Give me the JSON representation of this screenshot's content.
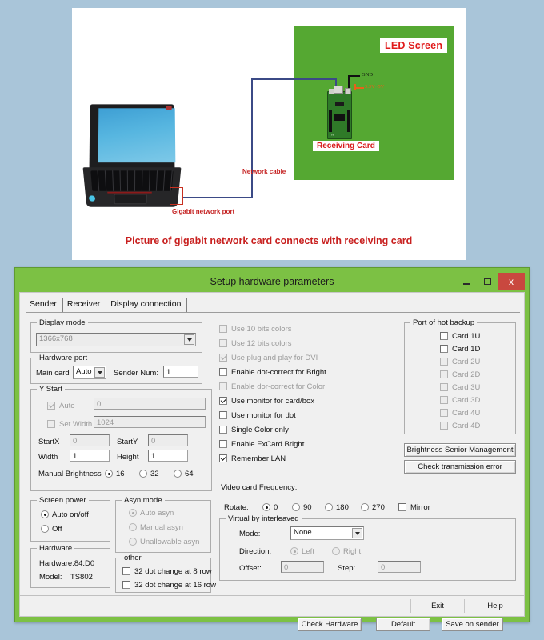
{
  "illustration": {
    "led_screen_label": "LED Screen",
    "receiving_card_label": "Receiving Card",
    "gnd_label": "GND",
    "voltage_label": "3.3V~5V",
    "network_cable_label": "Network cable",
    "gigabit_port_label": "Gigabit network port",
    "caption": "Picture of gigabit network card connects with receiving card",
    "colors": {
      "led_green": "#55a832",
      "red_text": "#c8201f",
      "cable_blue": "#3b4a86",
      "page_background": "#a9c5d9"
    }
  },
  "window": {
    "title": "Setup hardware parameters",
    "minimize_label": "–",
    "maximize_label": "□",
    "close_label": "x",
    "frame_color": "#7cc144",
    "close_color": "#c9483f"
  },
  "tabs": [
    {
      "label": "Sender",
      "active": true
    },
    {
      "label": "Receiver",
      "active": false
    },
    {
      "label": "Display connection",
      "active": false
    }
  ],
  "display_mode": {
    "legend": "Display mode",
    "value": "1366x768",
    "disabled": true
  },
  "hardware_port": {
    "legend": "Hardware port",
    "main_card_label": "Main card",
    "main_card_value": "Auto",
    "sender_num_label": "Sender Num:",
    "sender_num_value": "1"
  },
  "y_start": {
    "legend": "Y Start",
    "auto_label": "Auto",
    "auto_checked": true,
    "auto_value": "0",
    "set_width_label": "Set Width",
    "set_width_checked": false,
    "set_width_value": "1024",
    "startx_label": "StartX",
    "startx_value": "0",
    "starty_label": "StartY",
    "starty_value": "0",
    "width_label": "Width",
    "width_value": "1",
    "height_label": "Height",
    "height_value": "1",
    "manual_brightness_label": "Manual Brightness",
    "brightness_options": [
      {
        "label": "16",
        "selected": true
      },
      {
        "label": "32",
        "selected": false
      },
      {
        "label": "64",
        "selected": false
      }
    ]
  },
  "screen_power": {
    "legend": "Screen power",
    "options": [
      {
        "label": "Auto on/off",
        "selected": true
      },
      {
        "label": "Off",
        "selected": false
      }
    ]
  },
  "asyn_mode": {
    "legend": "Asyn mode",
    "disabled": true,
    "options": [
      {
        "label": "Auto asyn",
        "selected": true
      },
      {
        "label": "Manual asyn",
        "selected": false
      },
      {
        "label": "Unallowable asyn",
        "selected": false
      }
    ]
  },
  "hardware_info": {
    "legend": "Hardware",
    "hardware_line": "Hardware:84.D0",
    "model_line": "Model:    TS802"
  },
  "other": {
    "legend": "other",
    "items": [
      {
        "label": "32 dot change at 8 row",
        "checked": false
      },
      {
        "label": "32 dot change at 16 row",
        "checked": false
      }
    ]
  },
  "color_options": [
    {
      "label": "Use 10 bits colors",
      "checked": false,
      "disabled": true
    },
    {
      "label": "Use 12 bits colors",
      "checked": false,
      "disabled": true
    },
    {
      "label": "Use plug and play for DVI",
      "checked": true,
      "disabled": true
    },
    {
      "label": "Enable dot-correct for Bright",
      "checked": false,
      "disabled": false
    },
    {
      "label": "Enable dor-correct for Color",
      "checked": false,
      "disabled": true
    },
    {
      "label": "Use monitor for card/box",
      "checked": true,
      "disabled": false
    },
    {
      "label": "Use monitor for dot",
      "checked": false,
      "disabled": false
    },
    {
      "label": "Single Color only",
      "checked": false,
      "disabled": false
    },
    {
      "label": "Enable ExCard Bright",
      "checked": false,
      "disabled": false
    },
    {
      "label": "Remember LAN",
      "checked": true,
      "disabled": false
    }
  ],
  "hot_backup": {
    "legend": "Port of hot backup",
    "items": [
      {
        "label": "Card 1U",
        "checked": false,
        "disabled": false
      },
      {
        "label": "Card 1D",
        "checked": false,
        "disabled": false
      },
      {
        "label": "Card 2U",
        "checked": false,
        "disabled": true
      },
      {
        "label": "Card 2D",
        "checked": false,
        "disabled": true
      },
      {
        "label": "Card 3U",
        "checked": false,
        "disabled": true
      },
      {
        "label": "Card 3D",
        "checked": false,
        "disabled": true
      },
      {
        "label": "Card 4U",
        "checked": false,
        "disabled": true
      },
      {
        "label": "Card 4D",
        "checked": false,
        "disabled": true
      }
    ]
  },
  "side_buttons": {
    "brightness_senior": "Brightness Senior Management",
    "check_transmission": "Check transmission error"
  },
  "video_card": {
    "frequency_label": "Video card Frequency:",
    "rotate_label": "Rotate:",
    "rotate_options": [
      {
        "label": "0",
        "selected": true
      },
      {
        "label": "90",
        "selected": false
      },
      {
        "label": "180",
        "selected": false
      },
      {
        "label": "270",
        "selected": false
      }
    ],
    "mirror_label": "Mirror",
    "mirror_checked": false
  },
  "virtual": {
    "legend": "Virtual by interleaved",
    "mode_label": "Mode:",
    "mode_value": "None",
    "direction_label": "Direction:",
    "direction_options": [
      {
        "label": "Left",
        "selected": true
      },
      {
        "label": "Right",
        "selected": false
      }
    ],
    "offset_label": "Offset:",
    "offset_value": "0",
    "step_label": "Step:",
    "step_value": "0"
  },
  "action_buttons": {
    "check_hardware": "Check Hardware",
    "default": "Default",
    "save_on_sender": "Save on sender"
  },
  "footer_buttons": {
    "exit": "Exit",
    "help": "Help"
  }
}
